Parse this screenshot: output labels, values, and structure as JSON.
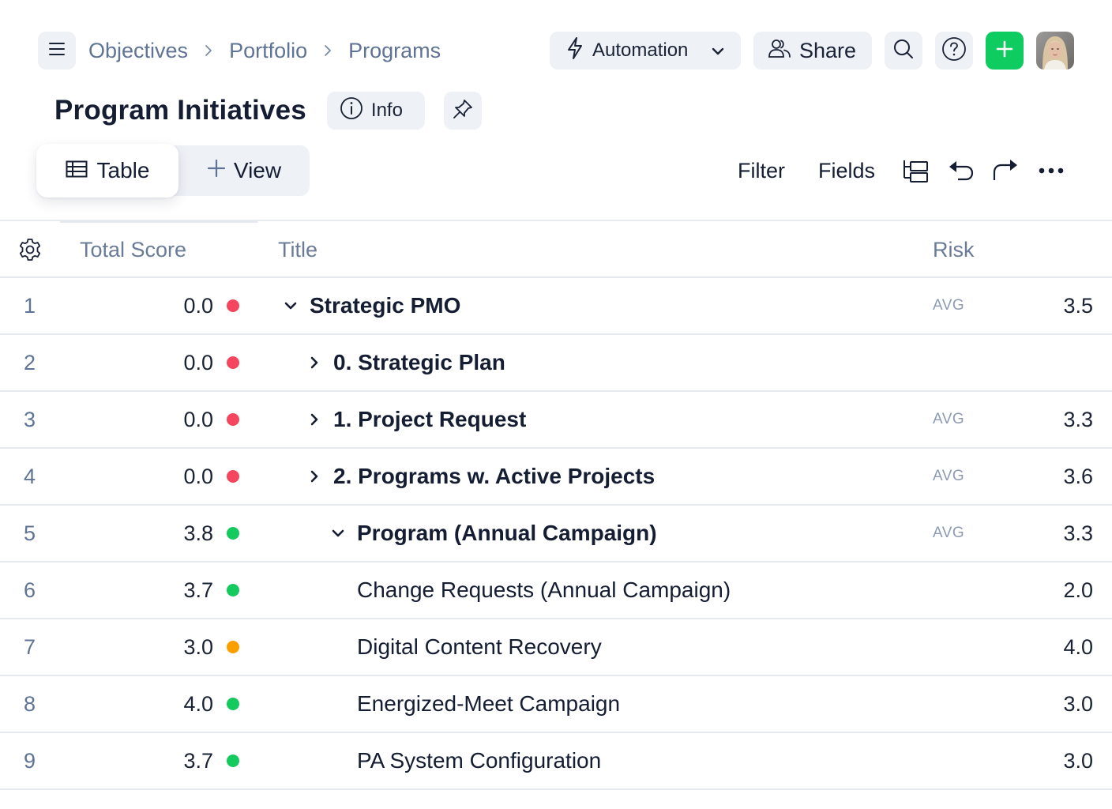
{
  "topbar": {
    "menu_icon": "hamburger-icon",
    "breadcrumb": [
      "Objectives",
      "Portfolio",
      "Programs"
    ],
    "automation_label": "Automation",
    "share_label": "Share",
    "search_icon": "search-icon",
    "help_icon": "help-icon",
    "add_icon": "plus-icon",
    "brand_color": "#0fcc60"
  },
  "page": {
    "title": "Program Initiatives",
    "info_label": "Info"
  },
  "views": {
    "tabs": [
      {
        "label": "Table",
        "icon": "table-icon",
        "active": true
      },
      {
        "label": "View",
        "icon": "plus-icon",
        "active": false
      }
    ]
  },
  "toolbar": {
    "filter_label": "Filter",
    "fields_label": "Fields"
  },
  "table": {
    "columns": {
      "settings_icon": "gear-icon",
      "score": "Total Score",
      "title": "Title",
      "risk": "Risk"
    },
    "status_colors": {
      "red": "#f4475f",
      "green": "#14c95e",
      "orange": "#fb9e00"
    },
    "rows": [
      {
        "num": "1",
        "score": "0.0",
        "status": "red",
        "caret": "down",
        "level": 0,
        "bold": true,
        "title": "Strategic PMO",
        "agg": "AVG",
        "risk": "3.5"
      },
      {
        "num": "2",
        "score": "0.0",
        "status": "red",
        "caret": "right",
        "level": 1,
        "bold": true,
        "title": "0. Strategic Plan",
        "agg": "",
        "risk": ""
      },
      {
        "num": "3",
        "score": "0.0",
        "status": "red",
        "caret": "right",
        "level": 1,
        "bold": true,
        "title": "1. Project Request",
        "agg": "AVG",
        "risk": "3.3"
      },
      {
        "num": "4",
        "score": "0.0",
        "status": "red",
        "caret": "right",
        "level": 1,
        "bold": true,
        "title": "2. Programs w. Active Projects",
        "agg": "AVG",
        "risk": "3.6"
      },
      {
        "num": "5",
        "score": "3.8",
        "status": "green",
        "caret": "down",
        "level": 2,
        "bold": true,
        "title": "Program (Annual Campaign)",
        "agg": "AVG",
        "risk": "3.3"
      },
      {
        "num": "6",
        "score": "3.7",
        "status": "green",
        "caret": "",
        "level": 3,
        "bold": false,
        "title": "Change Requests (Annual Campaign)",
        "agg": "",
        "risk": "2.0"
      },
      {
        "num": "7",
        "score": "3.0",
        "status": "orange",
        "caret": "",
        "level": 3,
        "bold": false,
        "title": "Digital Content Recovery",
        "agg": "",
        "risk": "4.0"
      },
      {
        "num": "8",
        "score": "4.0",
        "status": "green",
        "caret": "",
        "level": 3,
        "bold": false,
        "title": "Energized-Meet Campaign",
        "agg": "",
        "risk": "3.0"
      },
      {
        "num": "9",
        "score": "3.7",
        "status": "green",
        "caret": "",
        "level": 3,
        "bold": false,
        "title": "PA System Configuration",
        "agg": "",
        "risk": "3.0"
      }
    ]
  }
}
